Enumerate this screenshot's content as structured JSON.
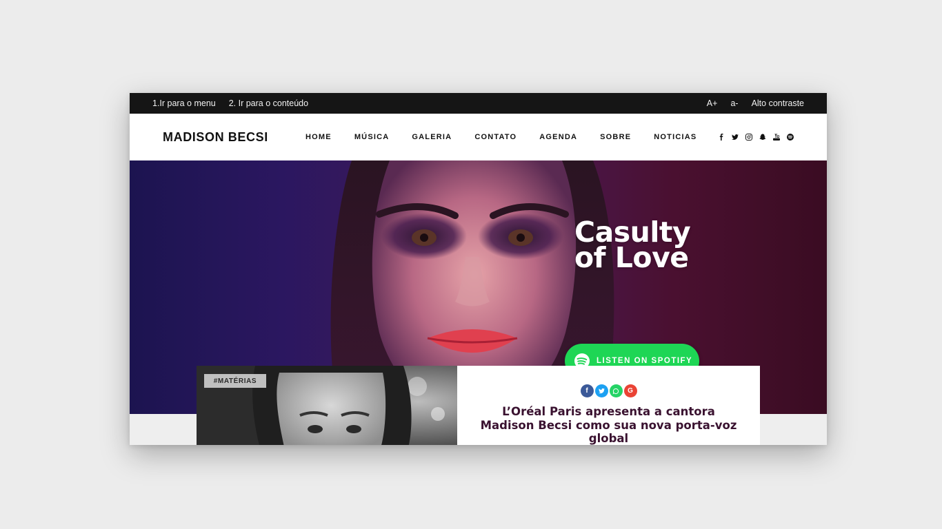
{
  "topbar": {
    "skip_menu": "1.Ir para o menu",
    "skip_content": "2. Ir para o conteúdo",
    "font_increase": "A+",
    "font_decrease": "a-",
    "contrast": "Alto contraste"
  },
  "header": {
    "logo": "MADISON BECSI",
    "nav": [
      "HOME",
      "MÚSICA",
      "GALERIA",
      "CONTATO",
      "AGENDA",
      "SOBRE",
      "NOTICIAS"
    ],
    "social_icons": [
      "facebook-icon",
      "twitter-icon",
      "instagram-icon",
      "snapchat-icon",
      "youtube-icon",
      "spotify-icon"
    ]
  },
  "hero": {
    "title_line1": "Casulty",
    "title_line2": "of Love",
    "cta_label": "LISTEN ON SPOTIFY"
  },
  "card": {
    "tag": "#MATÉRIAS",
    "share_icons": [
      "facebook-share-icon",
      "twitter-share-icon",
      "whatsapp-share-icon",
      "google-share-icon"
    ],
    "headline": "L’Oréal Paris apresenta a cantora Madison Becsi como sua nova porta-voz global"
  },
  "colors": {
    "topbar_bg": "#151515",
    "spotify_green": "#1ed655",
    "headline": "#3a1230",
    "facebook": "#3b5998",
    "twitter": "#1da1f2",
    "whatsapp": "#25d366",
    "google": "#ea4335"
  }
}
